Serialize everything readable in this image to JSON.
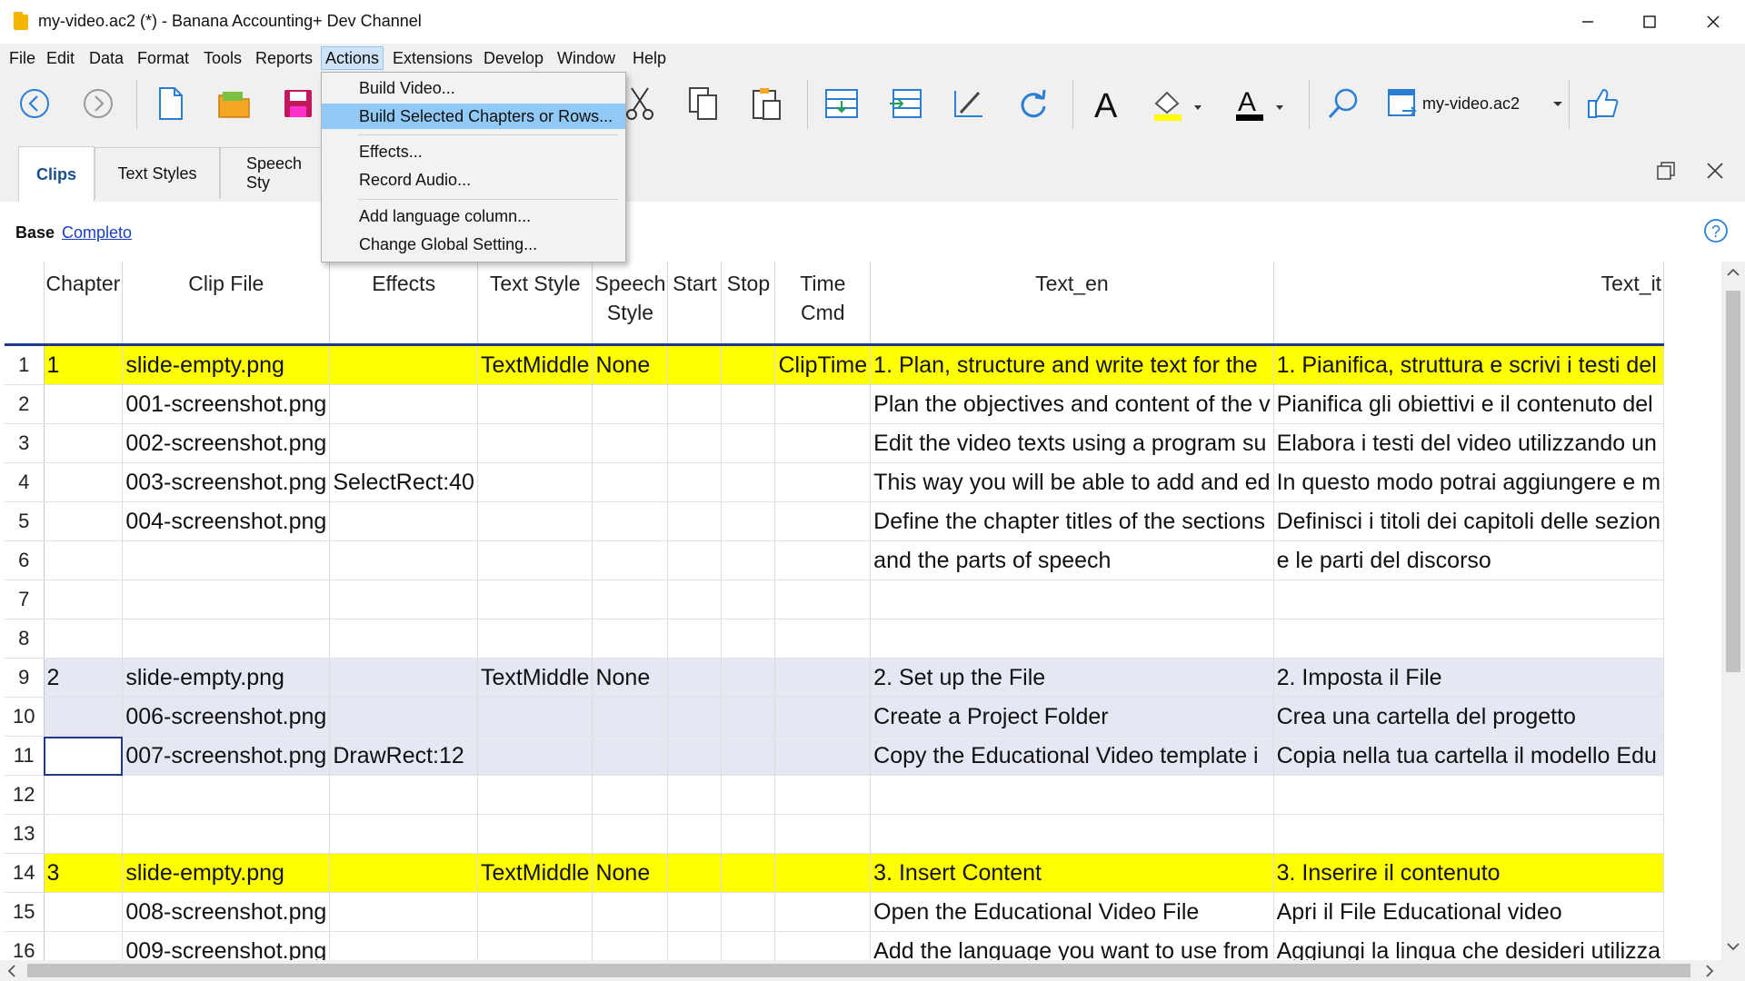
{
  "window": {
    "title": "my-video.ac2 (*) - Banana Accounting+ Dev Channel"
  },
  "menubar": {
    "items": [
      "File",
      "Edit",
      "Data",
      "Format",
      "Tools",
      "Reports",
      "Actions",
      "Extensions",
      "Develop",
      "Window",
      "Help"
    ]
  },
  "actions_menu": {
    "items": [
      "Build Video...",
      "Build Selected Chapters or Rows...",
      "Effects...",
      "Record Audio...",
      "Add language column...",
      "Change Global Setting..."
    ]
  },
  "toolbar": {
    "document_selector": "my-video.ac2"
  },
  "tabs": [
    "Clips",
    "Text Styles",
    "Speech Sty"
  ],
  "view": {
    "base_label": "Base",
    "link_label": "Completo"
  },
  "table": {
    "headers": [
      "Chapter",
      "Clip File",
      "Effects",
      "Text Style",
      "Speech Style",
      "Start",
      "Stop",
      "Time Cmd",
      "Text_en",
      "Text_it"
    ],
    "rows": [
      {
        "n": "1",
        "style": "yellow",
        "cells": [
          "1",
          "slide-empty.png",
          "",
          "TextMiddle",
          "None",
          "",
          "",
          "ClipTime",
          "1. Plan, structure and write text for the",
          "1. Pianifica, struttura e scrivi i testi del"
        ]
      },
      {
        "n": "2",
        "style": "",
        "cells": [
          "",
          "001-screenshot.png",
          "",
          "",
          "",
          "",
          "",
          "",
          "Plan the objectives and content of the v",
          "Pianifica gli obiettivi e il contenuto del"
        ]
      },
      {
        "n": "3",
        "style": "",
        "cells": [
          "",
          "002-screenshot.png",
          "",
          "",
          "",
          "",
          "",
          "",
          "Edit the video texts using a program su",
          "Elabora i testi del video utilizzando un"
        ]
      },
      {
        "n": "4",
        "style": "",
        "cells": [
          "",
          "003-screenshot.png",
          "SelectRect:40",
          "",
          "",
          "",
          "",
          "",
          "This way you will be able to add and ed",
          "In questo modo potrai aggiungere e m"
        ]
      },
      {
        "n": "5",
        "style": "",
        "cells": [
          "",
          "004-screenshot.png",
          "",
          "",
          "",
          "",
          "",
          "",
          "Define the chapter titles of the sections",
          "Definisci i titoli dei capitoli delle sezion"
        ]
      },
      {
        "n": "6",
        "style": "",
        "cells": [
          "",
          "",
          "",
          "",
          "",
          "",
          "",
          "",
          "and the parts of speech",
          "e le parti del discorso"
        ]
      },
      {
        "n": "7",
        "style": "",
        "cells": [
          "",
          "",
          "",
          "",
          "",
          "",
          "",
          "",
          "",
          ""
        ]
      },
      {
        "n": "8",
        "style": "",
        "cells": [
          "",
          "",
          "",
          "",
          "",
          "",
          "",
          "",
          "",
          ""
        ]
      },
      {
        "n": "9",
        "style": "blue",
        "cells": [
          "2",
          "slide-empty.png",
          "",
          "TextMiddle",
          "None",
          "",
          "",
          "",
          "2. Set up the File",
          "2. Imposta il File"
        ]
      },
      {
        "n": "10",
        "style": "blue",
        "cells": [
          "",
          "006-screenshot.png",
          "",
          "",
          "",
          "",
          "",
          "",
          "Create a Project Folder",
          "Crea una cartella del progetto"
        ]
      },
      {
        "n": "11",
        "style": "blue",
        "cells": [
          "",
          "007-screenshot.png",
          "DrawRect:12",
          "",
          "",
          "",
          "",
          "",
          "Copy the Educational Video template i",
          "Copia nella tua cartella il modello Edu"
        ]
      },
      {
        "n": "12",
        "style": "",
        "cells": [
          "",
          "",
          "",
          "",
          "",
          "",
          "",
          "",
          "",
          ""
        ]
      },
      {
        "n": "13",
        "style": "",
        "cells": [
          "",
          "",
          "",
          "",
          "",
          "",
          "",
          "",
          "",
          ""
        ]
      },
      {
        "n": "14",
        "style": "yellow",
        "cells": [
          "3",
          "slide-empty.png",
          "",
          "TextMiddle",
          "None",
          "",
          "",
          "",
          "3. Insert Content",
          "3. Inserire il contenuto"
        ]
      },
      {
        "n": "15",
        "style": "",
        "cells": [
          "",
          "008-screenshot.png",
          "",
          "",
          "",
          "",
          "",
          "",
          "Open the Educational Video File",
          "Apri il File Educational video"
        ]
      },
      {
        "n": "16",
        "style": "",
        "cells": [
          "",
          "009-screenshot.png",
          "",
          "",
          "",
          "",
          "",
          "",
          "Add the language you want to use from",
          "Aggiungi la lingua che desideri utilizza"
        ]
      }
    ]
  },
  "colors": {
    "chapter_row": "#ffff00",
    "group_row": "#e5e7f3",
    "header_underline": "#1f3a8a",
    "menu_highlight": "#91c9f7"
  },
  "icons": [
    "back-icon",
    "forward-icon",
    "new-file-icon",
    "open-folder-icon",
    "save-icon",
    "cut-icon",
    "copy-icon",
    "paste-icon",
    "insert-rows-icon",
    "move-rows-icon",
    "edit-icon",
    "refresh-icon",
    "font-icon",
    "fill-color-icon",
    "text-color-icon",
    "search-icon",
    "document-icon",
    "thumbs-up-icon"
  ]
}
